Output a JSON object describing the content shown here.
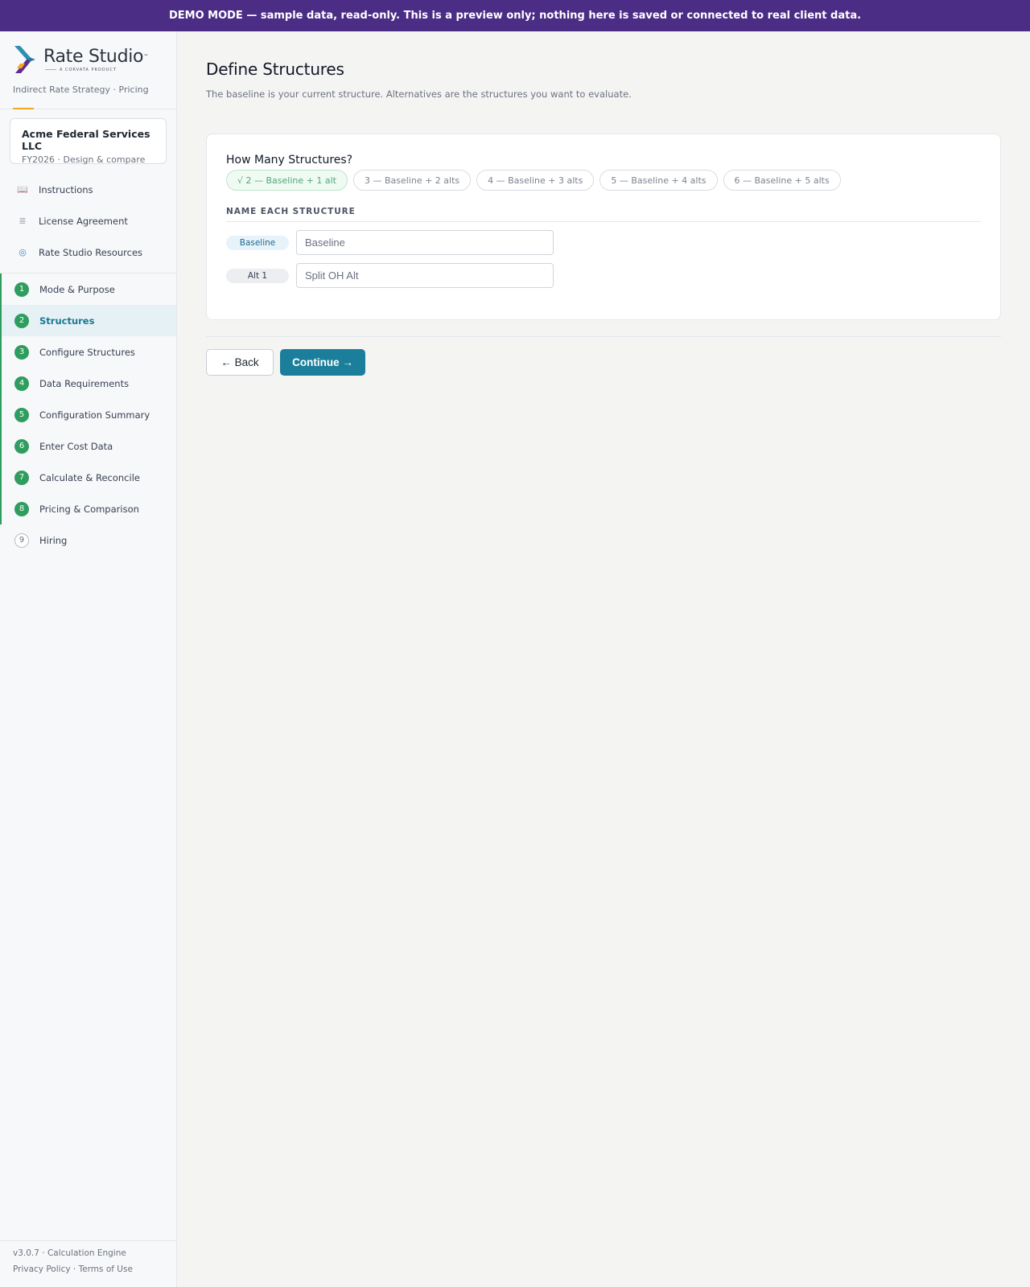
{
  "banner": {
    "text": "DEMO MODE — sample data, read-only. This is a preview only; nothing here is saved or connected to real client data."
  },
  "brand": {
    "name": "Rate Studio",
    "trademark": "™",
    "subtitle": "A CORVATA PRODUCT",
    "tagline": "Indirect Rate Strategy · Pricing",
    "colors": {
      "accent": "#f5a623",
      "teal": "#1b7f9c",
      "purple": "#4c2d86"
    }
  },
  "client": {
    "name": "Acme Federal Services LLC",
    "sub": "FY2026 · Design & compare"
  },
  "links": [
    {
      "label": "Instructions",
      "icon": "book-icon"
    },
    {
      "label": "License Agreement",
      "icon": "document-icon"
    },
    {
      "label": "Rate Studio Resources",
      "icon": "globe-icon"
    }
  ],
  "steps": [
    {
      "num": "1",
      "label": "Mode & Purpose",
      "state": "done"
    },
    {
      "num": "2",
      "label": "Structures",
      "state": "active"
    },
    {
      "num": "3",
      "label": "Configure Structures",
      "state": "done"
    },
    {
      "num": "4",
      "label": "Data Requirements",
      "state": "done"
    },
    {
      "num": "5",
      "label": "Configuration Summary",
      "state": "done"
    },
    {
      "num": "6",
      "label": "Enter Cost Data",
      "state": "done"
    },
    {
      "num": "7",
      "label": "Calculate & Reconcile",
      "state": "done"
    },
    {
      "num": "8",
      "label": "Pricing & Comparison",
      "state": "done"
    },
    {
      "num": "9",
      "label": "Hiring",
      "state": "todo"
    }
  ],
  "footer": {
    "version": "v3.0.7 · Calculation Engine",
    "legal": "Privacy Policy · Terms of Use"
  },
  "page": {
    "title": "Define Structures",
    "subtitle": "The baseline is your current structure. Alternatives are the structures you want to evaluate."
  },
  "structures": {
    "heading": "How Many Structures?",
    "options": [
      {
        "label": "√  2 — Baseline + 1 alt",
        "selected": true
      },
      {
        "label": "3 — Baseline + 2 alts",
        "selected": false
      },
      {
        "label": "4 — Baseline + 3 alts",
        "selected": false
      },
      {
        "label": "5 — Baseline + 4 alts",
        "selected": false
      },
      {
        "label": "6 — Baseline + 5 alts",
        "selected": false
      }
    ],
    "name_section_label": "NAME EACH STRUCTURE",
    "names": [
      {
        "tag": "Baseline",
        "value": "Baseline"
      },
      {
        "tag": "Alt 1",
        "value": "Split OH Alt"
      }
    ]
  },
  "actions": {
    "back": "← Back",
    "continue": "Continue →"
  }
}
